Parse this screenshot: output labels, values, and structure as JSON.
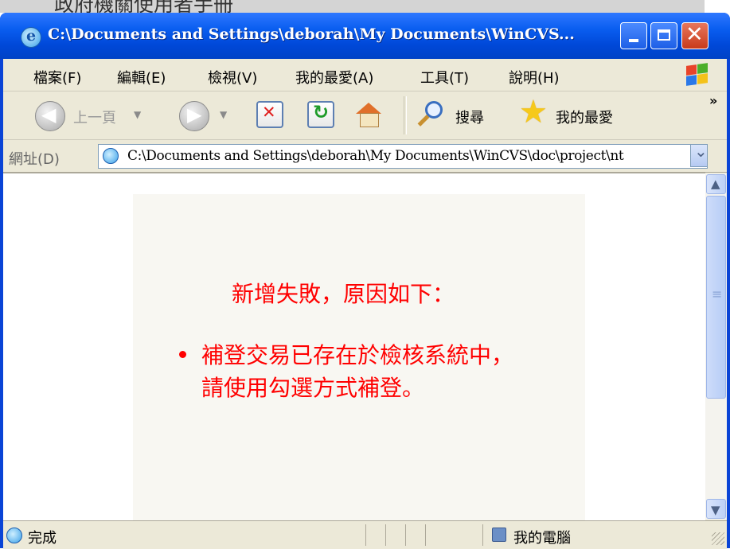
{
  "background_caption": "政府機關使用者手冊",
  "window": {
    "title": "C:\\Documents and Settings\\deborah\\My Documents\\WinCVS...",
    "minimize_glyph": "",
    "close_glyph": "✕"
  },
  "menu": {
    "items": [
      "檔案(F)",
      "編輯(E)",
      "檢視(V)",
      "我的最愛(A)",
      "工具(T)",
      "說明(H)"
    ]
  },
  "toolbar": {
    "back_label": "上一頁",
    "search_label": "搜尋",
    "favorites_label": "我的最愛",
    "more": "»"
  },
  "address": {
    "label": "網址(D)",
    "value": "C:\\Documents and Settings\\deborah\\My Documents\\WinCVS\\doc\\project\\nt"
  },
  "content": {
    "title": "新增失敗，原因如下：",
    "error_lines": [
      "補登交易已存在於檢核系統中，",
      "請使用勾選方式補登。"
    ],
    "text_color": "#ff0000"
  },
  "status": {
    "text": "完成",
    "zone": "我的電腦"
  },
  "colors": {
    "titlebar_blue": "#0a5ef0",
    "chrome": "#ece9d8",
    "error_red": "#ff0000"
  }
}
